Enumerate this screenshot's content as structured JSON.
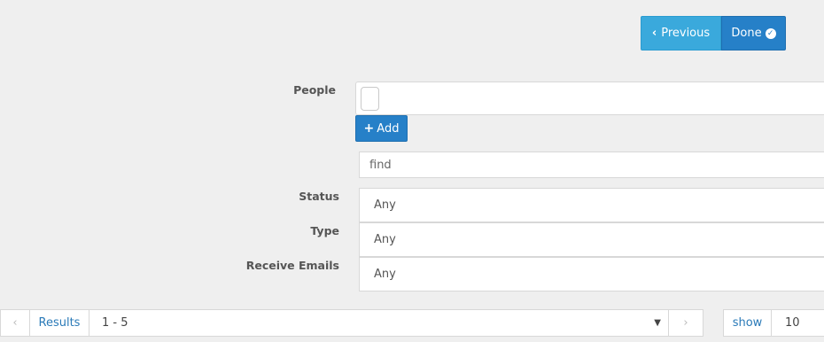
{
  "toolbar": {
    "previous_label": "Previous",
    "done_label": "Done"
  },
  "form": {
    "people_label": "People",
    "add_label": "Add",
    "find_placeholder": "find",
    "status_label": "Status",
    "status_value": "Any",
    "type_label": "Type",
    "type_value": "Any",
    "receive_emails_label": "Receive Emails",
    "receive_emails_value": "Any"
  },
  "pager": {
    "results_label": "Results",
    "range_value": "1 - 5",
    "show_label": "show",
    "page_size_value": "10"
  }
}
